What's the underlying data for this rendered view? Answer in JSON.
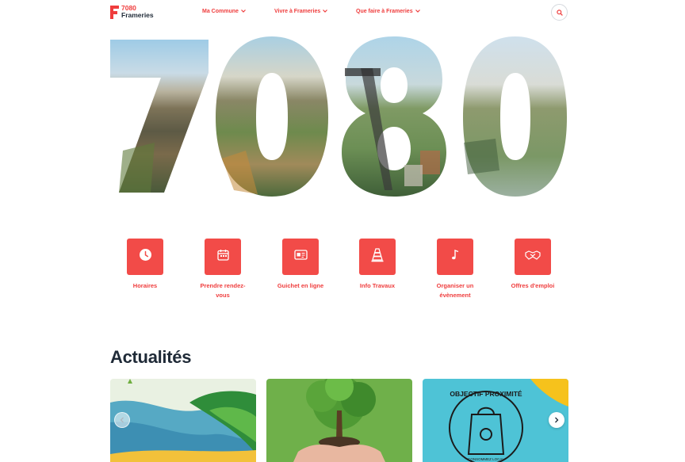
{
  "header": {
    "logo_number": "7080",
    "logo_name": "Frameries",
    "nav": [
      {
        "label": "Ma Commune"
      },
      {
        "label": "Vivre à Frameries"
      },
      {
        "label": "Que faire à Frameries"
      }
    ]
  },
  "hero": {
    "digits": "7080"
  },
  "quick_links": [
    {
      "label": "Horaires",
      "icon": "clock-icon"
    },
    {
      "label": "Prendre rendez-vous",
      "icon": "calendar-icon"
    },
    {
      "label": "Guichet en ligne",
      "icon": "id-card-icon"
    },
    {
      "label": "Info Travaux",
      "icon": "traffic-cone-icon"
    },
    {
      "label": "Organiser un évènement",
      "icon": "music-note-icon"
    },
    {
      "label": "Offres d'emploi",
      "icon": "handshake-icon"
    }
  ],
  "news": {
    "title": "Actualités",
    "card3_stamp_top": "OBJECTIF PROXIMITÉ",
    "card3_stamp_bottom": "CONSOMMEZ LOCAL"
  },
  "colors": {
    "accent": "#ef3d3d",
    "tile": "#f24b48",
    "text_dark": "#1f2a37"
  }
}
